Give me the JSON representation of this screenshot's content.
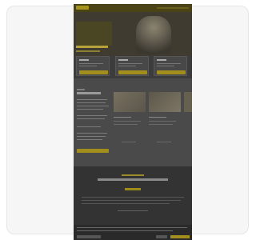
{
  "preview": {
    "image": "blurred-website-screenshot"
  }
}
